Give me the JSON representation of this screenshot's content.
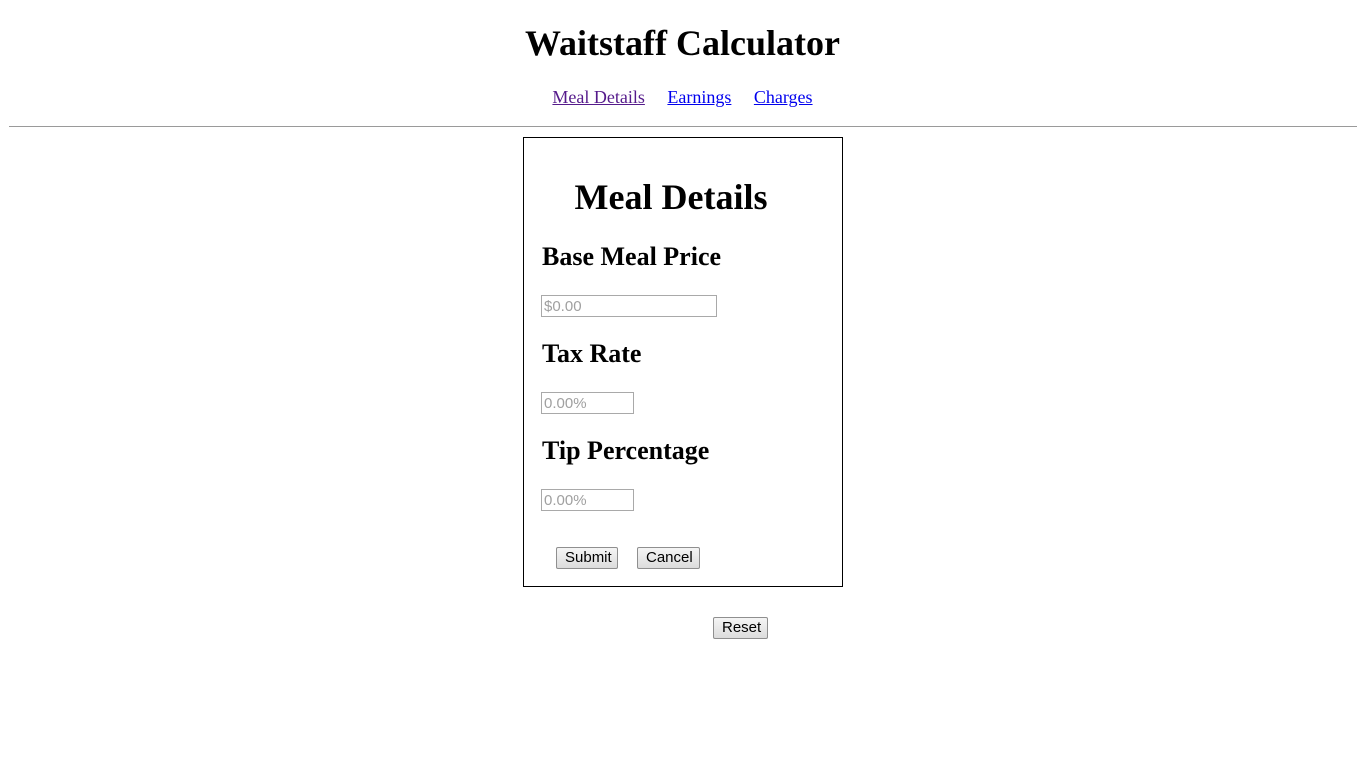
{
  "header": {
    "title": "Waitstaff Calculator"
  },
  "nav": {
    "items": [
      {
        "label": "Meal Details"
      },
      {
        "label": "Earnings"
      },
      {
        "label": "Charges"
      }
    ]
  },
  "meal_details": {
    "title": "Meal Details",
    "base_meal_price": {
      "label": "Base Meal Price",
      "value": "",
      "placeholder": "$0.00"
    },
    "tax_rate": {
      "label": "Tax Rate",
      "value": "",
      "placeholder": "0.00%"
    },
    "tip_percentage": {
      "label": "Tip Percentage",
      "value": "",
      "placeholder": "0.00%"
    },
    "submit_label": "Submit",
    "cancel_label": "Cancel"
  },
  "reset_label": "Reset"
}
